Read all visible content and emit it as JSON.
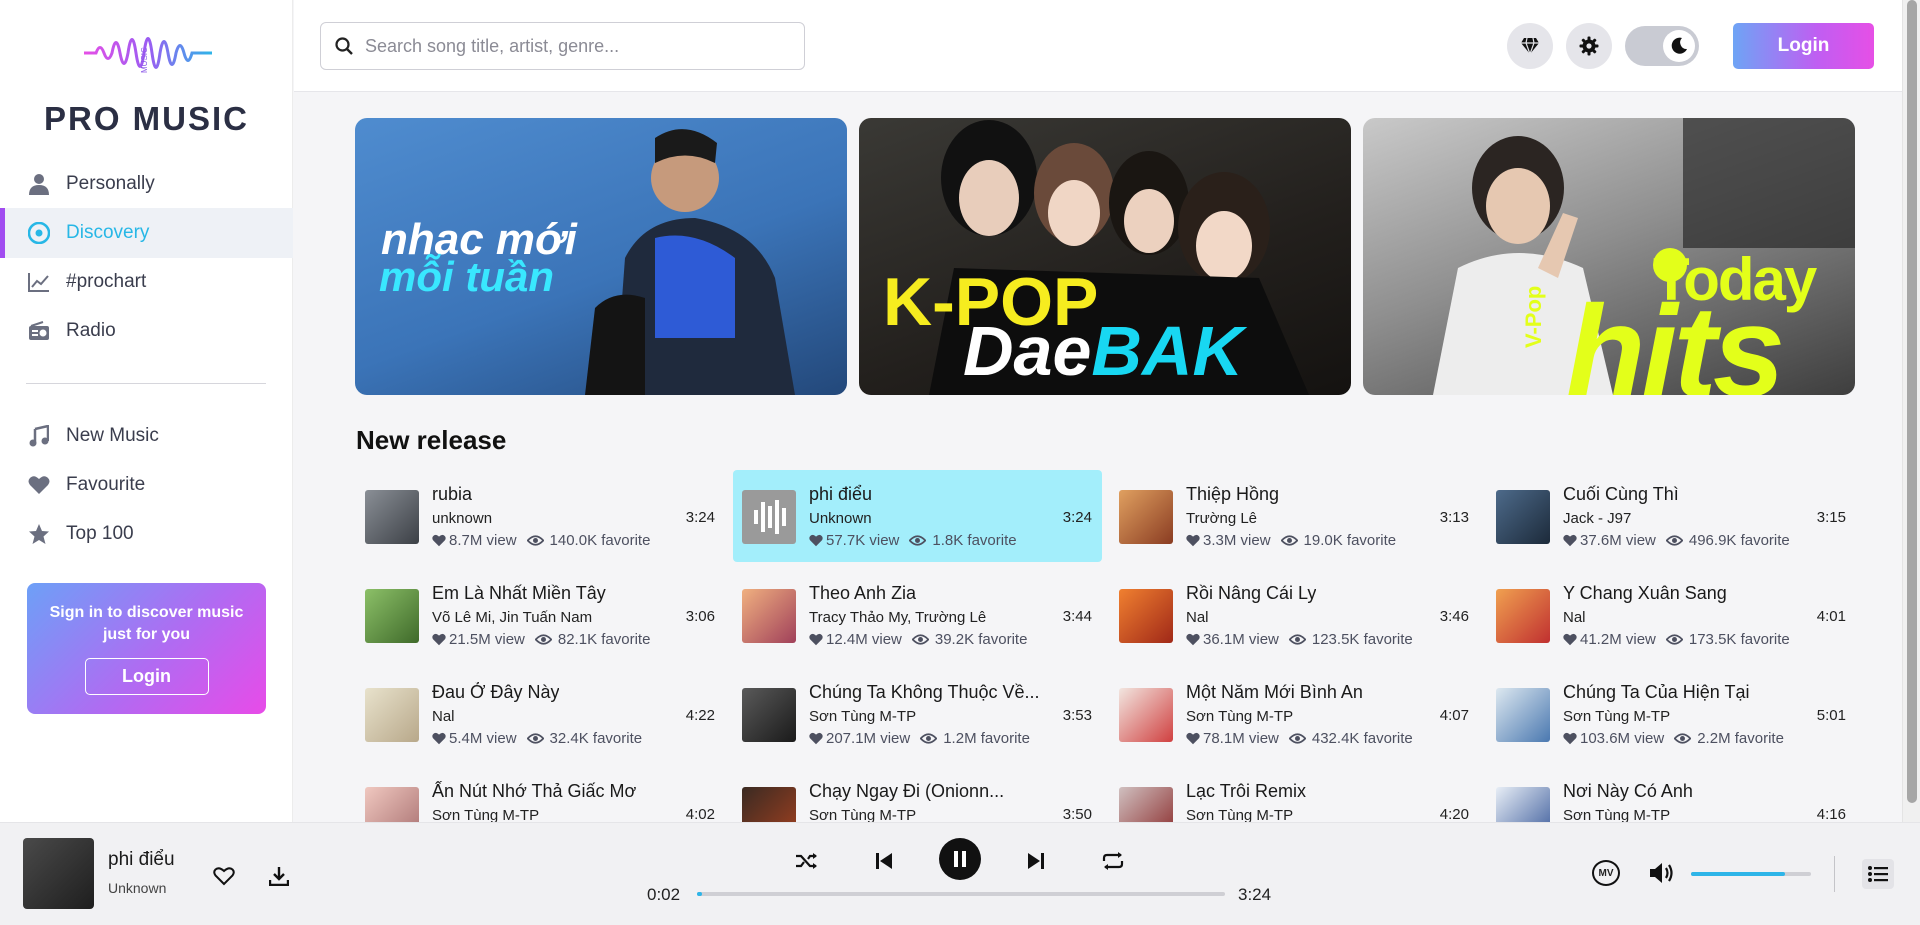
{
  "brand": {
    "name": "PRO MUSIC",
    "logo_text": "MUSIC"
  },
  "nav": {
    "main": [
      {
        "label": "Personally",
        "icon": "user-icon"
      },
      {
        "label": "Discovery",
        "icon": "disc-icon",
        "active": true
      },
      {
        "label": "#prochart",
        "icon": "chart-line-icon"
      },
      {
        "label": "Radio",
        "icon": "radio-icon"
      }
    ],
    "library": [
      {
        "label": "New Music",
        "icon": "music-note-icon"
      },
      {
        "label": "Favourite",
        "icon": "heart-icon"
      },
      {
        "label": "Top 100",
        "icon": "star-icon"
      }
    ]
  },
  "promo": {
    "text": "Sign in to discover music just for you",
    "button": "Login"
  },
  "header": {
    "search_placeholder": "Search song title, artist, genre...",
    "login_label": "Login"
  },
  "banners": [
    {
      "line1": "nhac mới",
      "line2": "mỗi tuần"
    },
    {
      "line1": "K-POP",
      "line2a": "Dae",
      "line2b": "BAK"
    },
    {
      "line1": "Today",
      "line2": "hits",
      "side": "V-Pop"
    }
  ],
  "section_title": "New release",
  "songs": [
    {
      "title": "rubia",
      "artist": "unknown",
      "views": "8.7M view",
      "favorites": "140.0K favorite",
      "duration": "3:24",
      "highlight": false
    },
    {
      "title": "phi điểu",
      "artist": "Unknown",
      "views": "57.7K view",
      "favorites": "1.8K favorite",
      "duration": "3:24",
      "highlight": true
    },
    {
      "title": "Thiệp Hồng",
      "artist": "Trường Lê",
      "views": "3.3M view",
      "favorites": "19.0K favorite",
      "duration": "3:13",
      "highlight": false
    },
    {
      "title": "Cuối Cùng Thì",
      "artist": "Jack - J97",
      "views": "37.6M view",
      "favorites": "496.9K favorite",
      "duration": "3:15",
      "highlight": false
    },
    {
      "title": "Em Là Nhất Miền Tây",
      "artist": "Võ Lê Mi, Jin Tuấn Nam",
      "views": "21.5M view",
      "favorites": "82.1K favorite",
      "duration": "3:06",
      "highlight": false
    },
    {
      "title": "Theo Anh Zia",
      "artist": "Tracy Thảo My, Trường Lê",
      "views": "12.4M view",
      "favorites": "39.2K favorite",
      "duration": "3:44",
      "highlight": false
    },
    {
      "title": "Rồi Nâng Cái Ly",
      "artist": "Nal",
      "views": "36.1M view",
      "favorites": "123.5K favorite",
      "duration": "3:46",
      "highlight": false
    },
    {
      "title": "Y Chang Xuân Sang",
      "artist": "Nal",
      "views": "41.2M view",
      "favorites": "173.5K favorite",
      "duration": "4:01",
      "highlight": false
    },
    {
      "title": "Đau Ở Đây Này",
      "artist": "Nal",
      "views": "5.4M view",
      "favorites": "32.4K favorite",
      "duration": "4:22",
      "highlight": false
    },
    {
      "title": "Chúng Ta Không Thuộc Về...",
      "artist": "Sơn Tùng M-TP",
      "views": "207.1M view",
      "favorites": "1.2M favorite",
      "duration": "3:53",
      "highlight": false
    },
    {
      "title": "Một Năm Mới Bình An",
      "artist": "Sơn Tùng M-TP",
      "views": "78.1M view",
      "favorites": "432.4K favorite",
      "duration": "4:07",
      "highlight": false
    },
    {
      "title": "Chúng Ta Của Hiện Tại",
      "artist": "Sơn Tùng M-TP",
      "views": "103.6M view",
      "favorites": "2.2M favorite",
      "duration": "5:01",
      "highlight": false
    },
    {
      "title": "Ấn Nút Nhớ Thả Giấc Mơ",
      "artist": "Sơn Tùng M-TP",
      "views": "",
      "favorites": "",
      "duration": "4:02",
      "highlight": false
    },
    {
      "title": "Chạy Ngay Đi (Onionn...",
      "artist": "Sơn Tùng M-TP",
      "views": "",
      "favorites": "",
      "duration": "3:50",
      "highlight": false
    },
    {
      "title": "Lạc Trôi Remix",
      "artist": "Sơn Tùng M-TP",
      "views": "",
      "favorites": "",
      "duration": "4:20",
      "highlight": false
    },
    {
      "title": "Nơi Này Có Anh",
      "artist": "Sơn Tùng M-TP",
      "views": "",
      "favorites": "",
      "duration": "4:16",
      "highlight": false
    }
  ],
  "player": {
    "title": "phi điểu",
    "artist": "Unknown",
    "current_time": "0:02",
    "total_time": "3:24",
    "progress": 0.01,
    "volume": 0.78,
    "mv_label": "MV"
  },
  "colors": {
    "accent": "#2eb5e8",
    "highlight": "#a3eefb",
    "brand_gradient_start": "#6ea4f5",
    "brand_gradient_end": "#e64fe6"
  }
}
